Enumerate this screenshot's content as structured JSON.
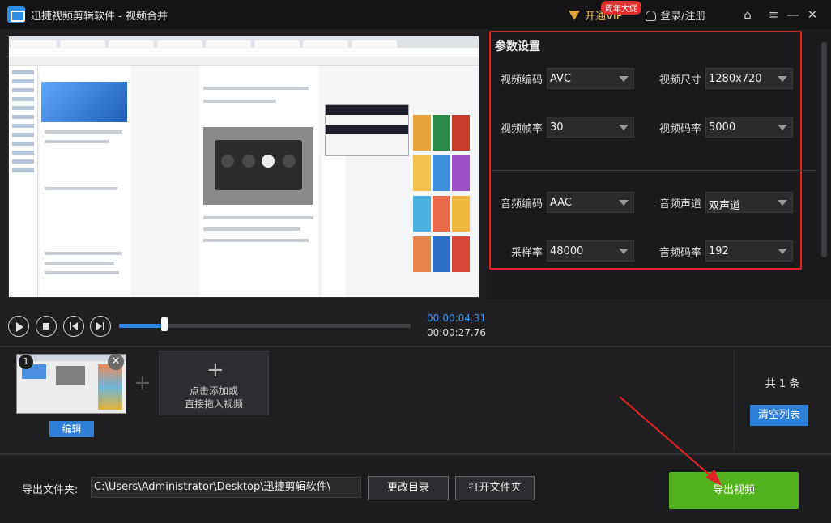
{
  "window": {
    "title": "迅捷视频剪辑软件 - 视频合并",
    "vip_label": "开通VIP",
    "promo_badge": "周年大促",
    "login_label": "登录/注册",
    "icons": [
      "home-icon",
      "menu-icon",
      "minimize-icon",
      "close-icon"
    ]
  },
  "params": {
    "title": "参数设置",
    "video_codec": {
      "label": "视频编码",
      "value": "AVC"
    },
    "video_size": {
      "label": "视频尺寸",
      "value": "1280x720"
    },
    "frame_rate": {
      "label": "视频帧率",
      "value": "30"
    },
    "video_bitrate": {
      "label": "视频码率",
      "value": "5000"
    },
    "audio_codec": {
      "label": "音频编码",
      "value": "AAC"
    },
    "audio_channel": {
      "label": "音频声道",
      "value": "双声道"
    },
    "sample_rate": {
      "label": "采样率",
      "value": "48000"
    },
    "audio_bitrate": {
      "label": "音频码率",
      "value": "192"
    }
  },
  "playback": {
    "current_time": "00:00:04.31",
    "total_time": "00:00:27.76",
    "progress": 0.155
  },
  "clips": {
    "items": [
      {
        "index": "1",
        "edit_label": "编辑"
      }
    ],
    "add_line1": "点击添加或",
    "add_line2": "直接拖入视频",
    "count_label": "共 1 条",
    "clear_label": "清空列表"
  },
  "output": {
    "folder_label": "导出文件夹:",
    "folder_path": "C:\\Users\\Administrator\\Desktop\\迅捷剪辑软件\\",
    "change_dir_label": "更改目录",
    "open_folder_label": "打开文件夹",
    "export_label": "导出视频"
  },
  "colors": {
    "accent_blue": "#2e7fd8",
    "export_green": "#53b31e",
    "annotation_red": "#e0242a",
    "vip_gold": "#e9c46a"
  }
}
